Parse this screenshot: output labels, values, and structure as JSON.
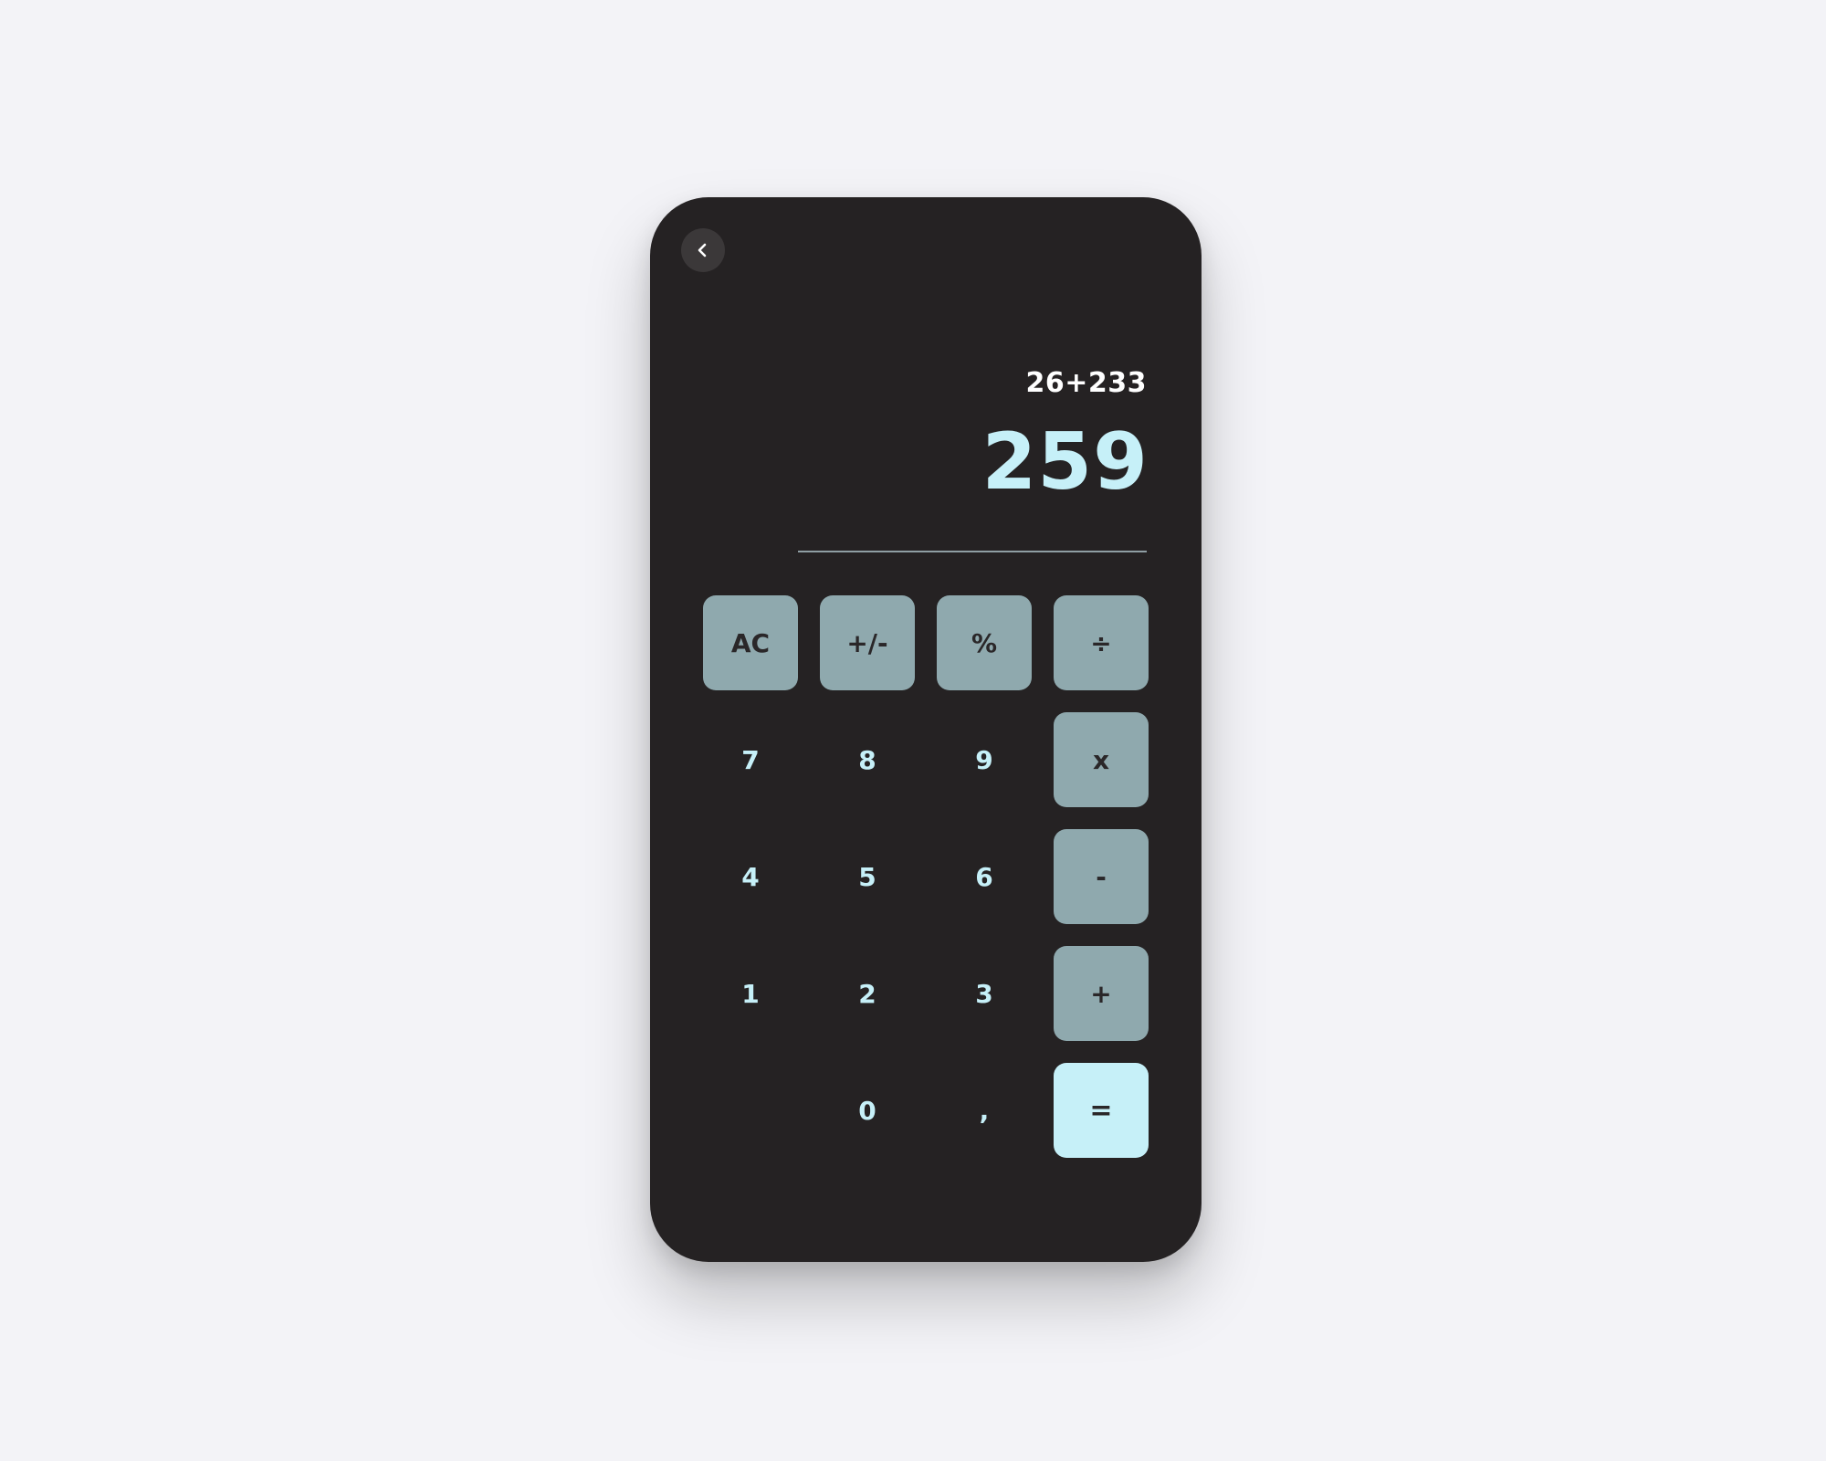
{
  "display": {
    "expression": "26+233",
    "result": "259"
  },
  "keys": {
    "ac": "AC",
    "plus_minus": "+/-",
    "percent": "%",
    "divide": "÷",
    "seven": "7",
    "eight": "8",
    "nine": "9",
    "multiply": "x",
    "four": "4",
    "five": "5",
    "six": "6",
    "minus": "-",
    "one": "1",
    "two": "2",
    "three": "3",
    "plus": "+",
    "zero": "0",
    "decimal": ",",
    "equals": "="
  },
  "icons": {
    "back": "chevron-left-icon"
  },
  "colors": {
    "background": "#f3f3f7",
    "phone": "#252223",
    "function_key": "#8fa9ae",
    "accent": "#c6f0f8",
    "dark_text": "#2a2729"
  }
}
